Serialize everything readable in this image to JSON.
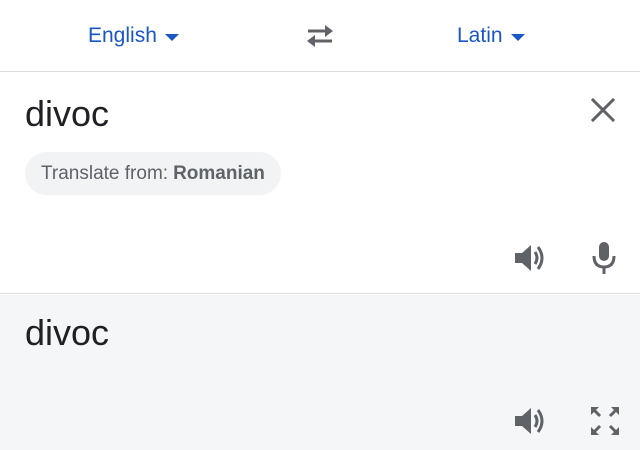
{
  "language_bar": {
    "source_language": "English",
    "target_language": "Latin",
    "swap_icon": "swap-arrows-icon"
  },
  "input": {
    "text": "divoc",
    "clear_icon": "close-icon",
    "detect_prefix": "Translate from:",
    "detected_language": "Romanian",
    "speak_icon": "speaker-icon",
    "mic_icon": "microphone-icon"
  },
  "output": {
    "text": "divoc",
    "speak_icon": "speaker-icon",
    "fullscreen_icon": "fullscreen-icon"
  },
  "colors": {
    "accent": "#1a56c4",
    "icon": "#5f6368",
    "output_bg": "#f5f6f8",
    "chip_bg": "#f1f3f4"
  }
}
